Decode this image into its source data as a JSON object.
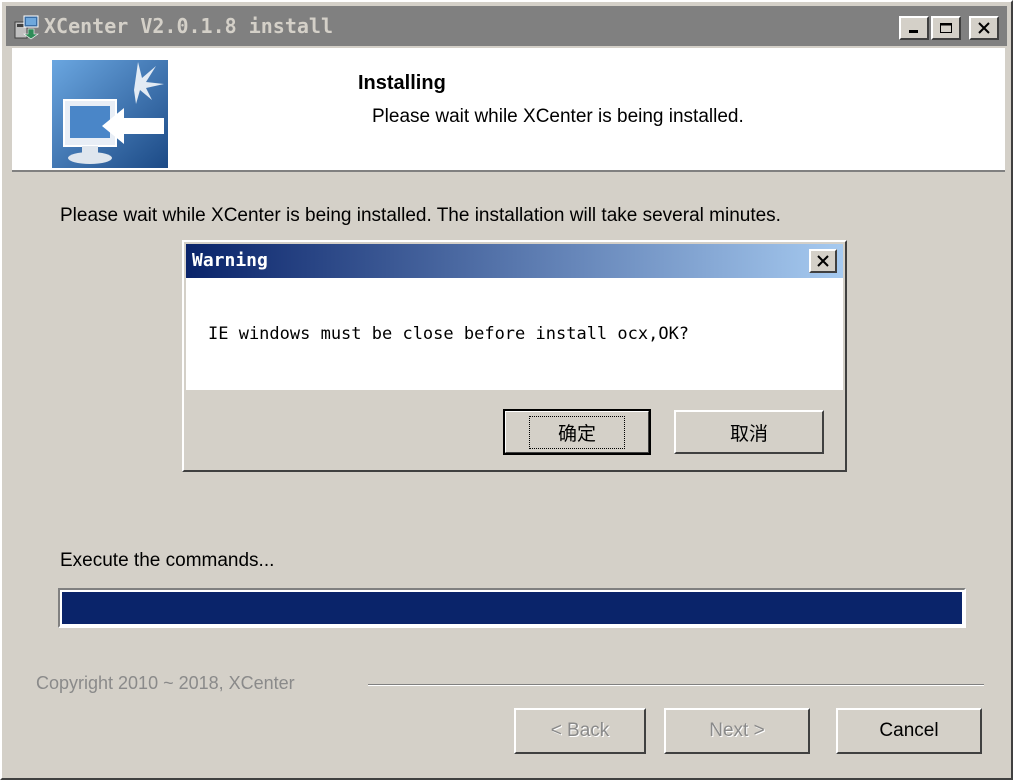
{
  "window": {
    "title": "XCenter V2.0.1.8 install",
    "title_bar_color": "#808080",
    "controls": [
      "minimize-icon",
      "maximize-icon",
      "close-icon"
    ]
  },
  "header": {
    "title": "Installing",
    "subtitle": "Please wait while XCenter is being installed.",
    "icon": "installer-monitor-icon"
  },
  "body": {
    "message": "Please wait while XCenter is being installed. The installation will take several minutes.",
    "status": "Execute the commands...",
    "progress": 1.0,
    "progress_color": "#0a246a"
  },
  "footer": {
    "copyright": "Copyright 2010 ~ 2018, XCenter",
    "back_label": "< Back",
    "next_label": "Next >",
    "cancel_label": "Cancel"
  },
  "dialog": {
    "title": "Warning",
    "message": "IE windows must be close before install ocx,OK?",
    "ok_label": "确定",
    "cancel_label": "取消",
    "title_gradient": [
      "#0a246a",
      "#a6caf0"
    ]
  }
}
